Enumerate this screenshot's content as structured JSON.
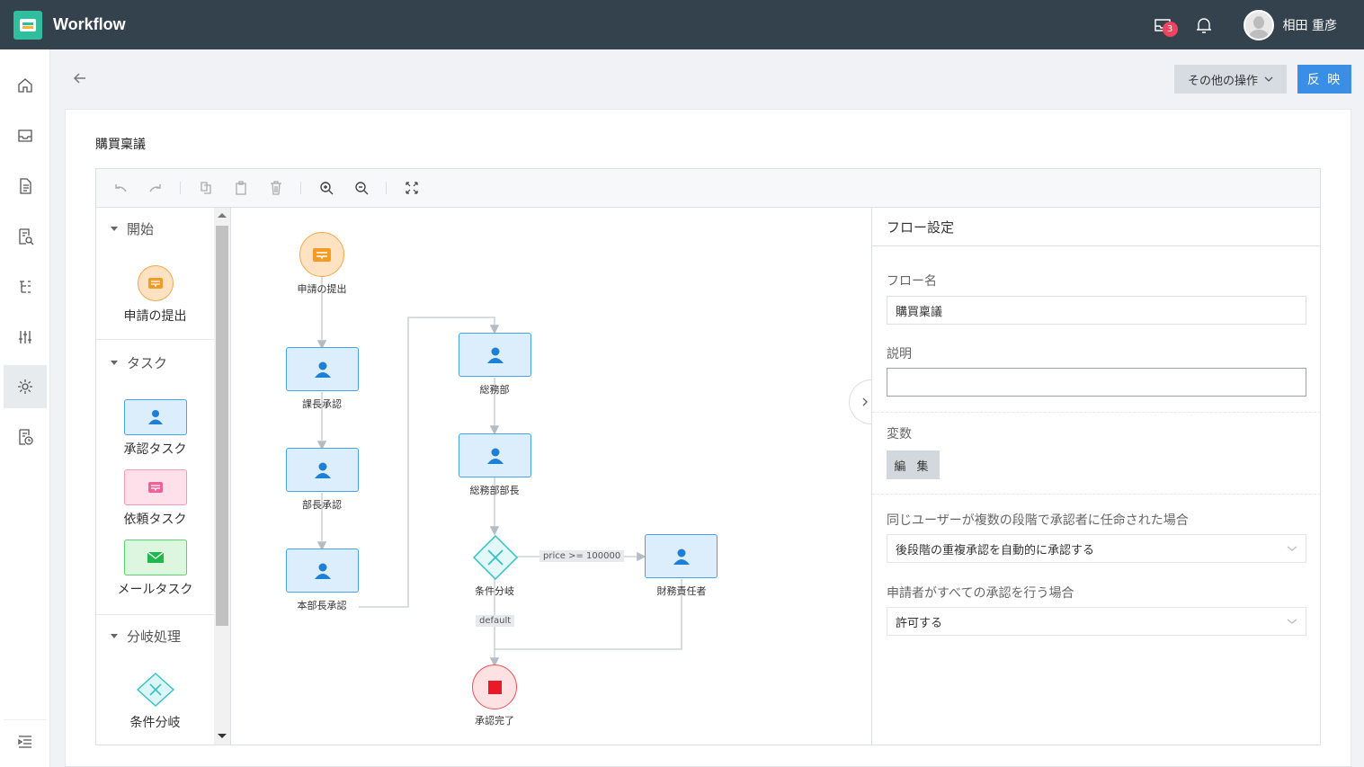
{
  "header": {
    "app_title": "Workflow",
    "inbox_badge": "3",
    "user_name": "相田 重彦"
  },
  "actions": {
    "other_label": "その他の操作",
    "apply_label": "反 映"
  },
  "page": {
    "title": "購買稟議"
  },
  "palette": {
    "groups": [
      {
        "label": "開始",
        "items": [
          "申請の提出"
        ]
      },
      {
        "label": "タスク",
        "items": [
          "承認タスク",
          "依頼タスク",
          "メールタスク"
        ]
      },
      {
        "label": "分岐処理",
        "items": [
          "条件分岐"
        ]
      }
    ]
  },
  "flow": {
    "nodes": {
      "start": "申請の提出",
      "section_chief": "課長承認",
      "dept_head": "部長承認",
      "division_head": "本部長承認",
      "general_affairs": "総務部",
      "general_affairs_head": "総務部部長",
      "condition": "条件分岐",
      "finance": "財務責任者",
      "end": "承認完了"
    },
    "edges": {
      "condition_true": "price >= 100000",
      "condition_default": "default"
    }
  },
  "settings": {
    "title": "フロー設定",
    "flow_name_label": "フロー名",
    "flow_name_value": "購買稟議",
    "description_label": "説明",
    "description_value": "",
    "variables_label": "変数",
    "edit_label": "編 集",
    "same_user_label": "同じユーザーが複数の段階で承認者に任命された場合",
    "same_user_value": "後段階の重複承認を自動的に承認する",
    "applicant_label": "申請者がすべての承認を行う場合",
    "applicant_value": "許可する"
  },
  "colors": {
    "topbar": "#34424e",
    "primary": "#3a8ee6",
    "task_fill": "#dceefc",
    "task_border": "#4aa3ea",
    "start_border": "#f5a64a",
    "end_border": "#ef4f5c",
    "condition_color": "#33c2c8",
    "badge": "#f0435f"
  }
}
